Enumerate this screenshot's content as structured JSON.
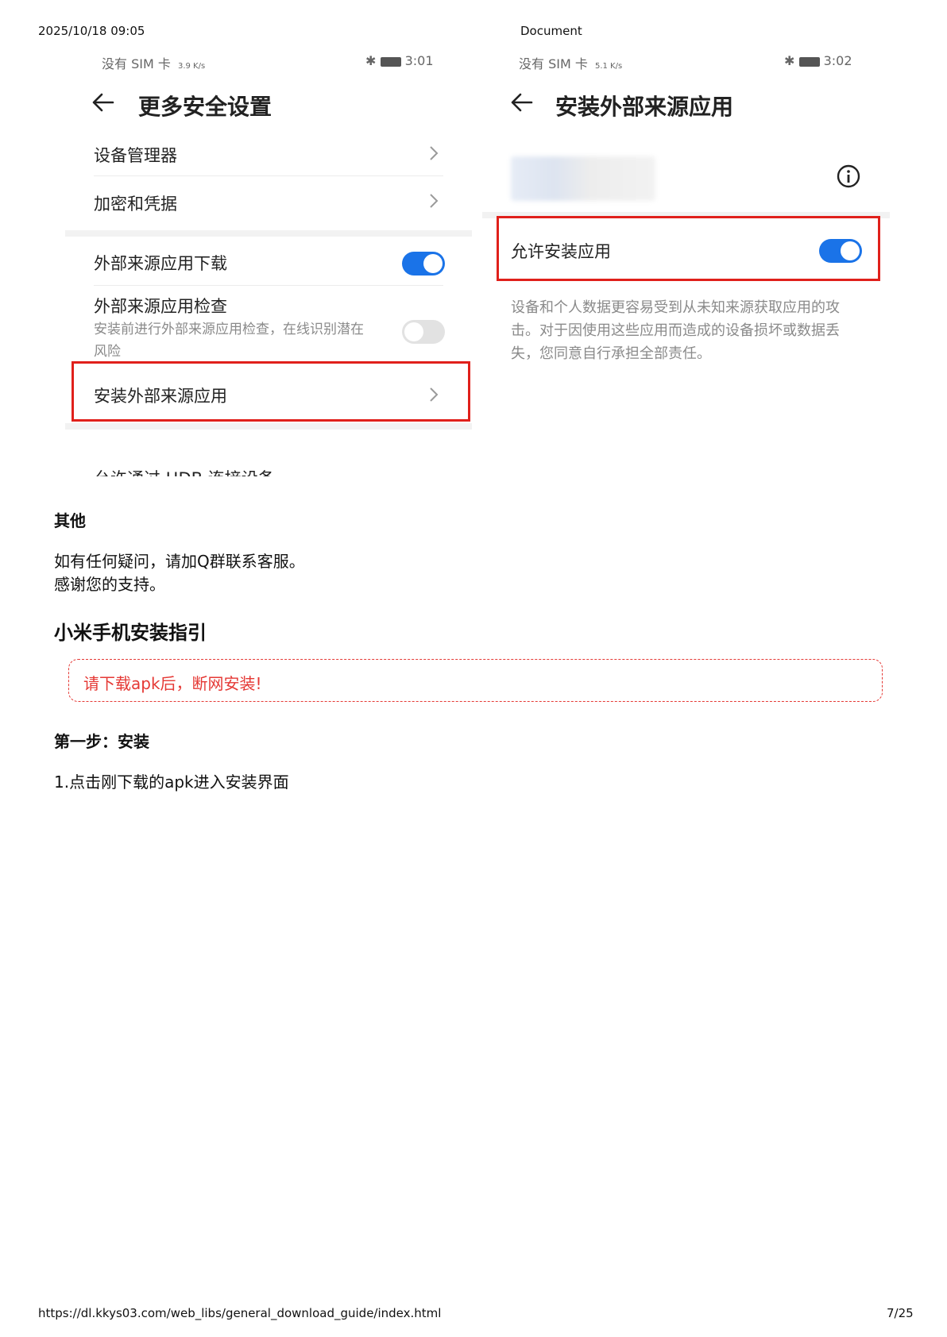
{
  "header": {
    "datetime": "2025/10/18 09:05",
    "doc_title": "Document"
  },
  "footer": {
    "url": "https://dl.kkys03.com/web_libs/general_download_guide/index.html",
    "page": "7/25"
  },
  "shot_left": {
    "status_left": "没有 SIM 卡",
    "status_speed": "3.9 K/s",
    "status_time": "3:01",
    "title": "更多安全设置",
    "rows": {
      "device_manager": "设备管理器",
      "encryption": "加密和凭据",
      "external_download": "外部来源应用下载",
      "external_check": "外部来源应用检查",
      "external_check_desc": "安装前进行外部来源应用检查，在线识别潜在风险",
      "install_external": "安装外部来源应用",
      "cut_off": "允许通过 HDB 连接设备"
    }
  },
  "shot_right": {
    "status_left": "没有 SIM 卡",
    "status_speed": "5.1 K/s",
    "status_time": "3:02",
    "title": "安装外部来源应用",
    "allow_install": "允许安装应用",
    "warning": "设备和个人数据更容易受到从未知来源获取应用的攻击。对于因使用这些应用而造成的设备损坏或数据丢失，您同意自行承担全部责任。"
  },
  "content": {
    "other_heading": "其他",
    "other_line1": "如有任何疑问，请加Q群联系客服。",
    "other_line2": "感谢您的支持。",
    "xiaomi_heading": "小米手机安装指引",
    "notice": "请下载apk后，断网安装!",
    "step1_heading": "第一步：安装",
    "step1_item": "1.点击刚下载的apk进入安装界面"
  }
}
